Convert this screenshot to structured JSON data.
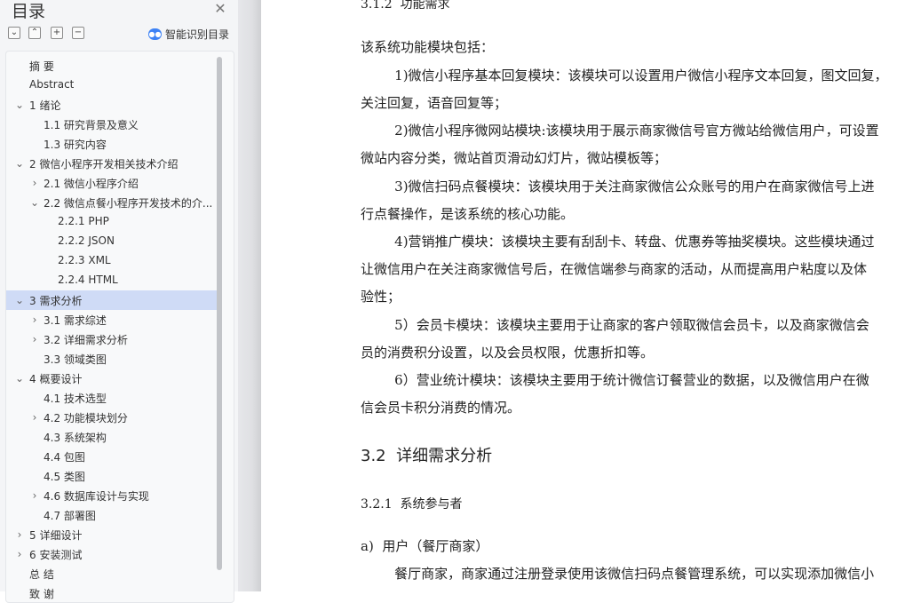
{
  "sidebar": {
    "title": "目录",
    "smart_toc_label": "智能识别目录",
    "items": [
      {
        "label": "摘    要",
        "level": 1,
        "expander": "none"
      },
      {
        "label": "Abstract",
        "level": 1,
        "expander": "none"
      },
      {
        "label": "1 绪论",
        "level": 1,
        "expander": "expanded"
      },
      {
        "label": "1.1 研究背景及意义",
        "level": 2,
        "expander": "none"
      },
      {
        "label": "1.3 研究内容",
        "level": 2,
        "expander": "none"
      },
      {
        "label": "2 微信小程序开发相关技术介绍",
        "level": 1,
        "expander": "expanded"
      },
      {
        "label": "2.1 微信小程序介绍",
        "level": 2,
        "expander": "collapsed"
      },
      {
        "label": "2.2 微信点餐小程序开发技术的介...",
        "level": 2,
        "expander": "expanded"
      },
      {
        "label": "2.2.1 PHP",
        "level": 3,
        "expander": "none"
      },
      {
        "label": "2.2.2 JSON",
        "level": 3,
        "expander": "none"
      },
      {
        "label": "2.2.3 XML",
        "level": 3,
        "expander": "none"
      },
      {
        "label": "2.2.4 HTML",
        "level": 3,
        "expander": "none"
      },
      {
        "label": "3 需求分析",
        "level": 1,
        "expander": "expanded",
        "selected": true
      },
      {
        "label": "3.1 需求综述",
        "level": 2,
        "expander": "collapsed"
      },
      {
        "label": "3.2  详细需求分析",
        "level": 2,
        "expander": "collapsed"
      },
      {
        "label": "3.3 领域类图",
        "level": 2,
        "expander": "none"
      },
      {
        "label": "4 概要设计",
        "level": 1,
        "expander": "expanded"
      },
      {
        "label": "4.1  技术选型",
        "level": 2,
        "expander": "none"
      },
      {
        "label": "4.2  功能模块划分",
        "level": 2,
        "expander": "collapsed"
      },
      {
        "label": "4.3  系统架构",
        "level": 2,
        "expander": "none"
      },
      {
        "label": "4.4  包图",
        "level": 2,
        "expander": "none"
      },
      {
        "label": "4.5  类图",
        "level": 2,
        "expander": "none"
      },
      {
        "label": "4.6  数据库设计与实现",
        "level": 2,
        "expander": "collapsed"
      },
      {
        "label": "4.7  部署图",
        "level": 2,
        "expander": "none"
      },
      {
        "label": "5 详细设计",
        "level": 1,
        "expander": "collapsed"
      },
      {
        "label": "6 安装测试",
        "level": 1,
        "expander": "collapsed"
      },
      {
        "label": "总    结",
        "level": 1,
        "expander": "none"
      },
      {
        "label": "致    谢",
        "level": 1,
        "expander": "none"
      }
    ]
  },
  "document": {
    "lines": [
      {
        "text": "3.1.2  功能需求",
        "style": "h3"
      },
      {
        "text": "该系统功能模块包括：",
        "style": "body"
      },
      {
        "text": "        1)微信小程序基本回复模块：该模块可以设置用户微信小程序文本回复，图文回复，",
        "style": "body"
      },
      {
        "text": "关注回复，语音回复等；",
        "style": "body"
      },
      {
        "text": "        2)微信小程序微网站模块:该模块用于展示商家微信号官方微站给微信用户，可设置",
        "style": "body"
      },
      {
        "text": "微站内容分类，微站首页滑动幻灯片，微站模板等；",
        "style": "body"
      },
      {
        "text": "        3)微信扫码点餐模块：该模块用于关注商家微信公众账号的用户在商家微信号上进",
        "style": "body"
      },
      {
        "text": "行点餐操作，是该系统的核心功能。",
        "style": "body"
      },
      {
        "text": "        4)营销推广模块：该模块主要有刮刮卡、转盘、优惠券等抽奖模块。这些模块通过",
        "style": "body"
      },
      {
        "text": "让微信用户在关注商家微信号后，在微信端参与商家的活动，从而提高用户粘度以及体",
        "style": "body"
      },
      {
        "text": "验性；",
        "style": "body"
      },
      {
        "text": "        5）会员卡模块：该模块主要用于让商家的客户领取微信会员卡，以及商家微信会",
        "style": "body"
      },
      {
        "text": "员的消费积分设置，以及会员权限，优惠折扣等。",
        "style": "body"
      },
      {
        "text": "        6）营业统计模块：该模块主要用于统计微信订餐营业的数据，以及微信用户在微",
        "style": "body"
      },
      {
        "text": "信会员卡积分消费的情况。",
        "style": "body"
      },
      {
        "text": "3.2  详细需求分析",
        "style": "h2"
      },
      {
        "text": "3.2.1  系统参与者",
        "style": "h3"
      },
      {
        "text": "a)  用户（餐厅商家）",
        "style": "body"
      },
      {
        "text": "        餐厅商家，商家通过注册登录使用该微信扫码点餐管理系统，可以实现添加微信小",
        "style": "body"
      }
    ]
  },
  "colors": {
    "selected_row": "#cfdbf6",
    "smart_icon": "#3d82f5",
    "sidebar_bg": "#f4f5f7"
  }
}
